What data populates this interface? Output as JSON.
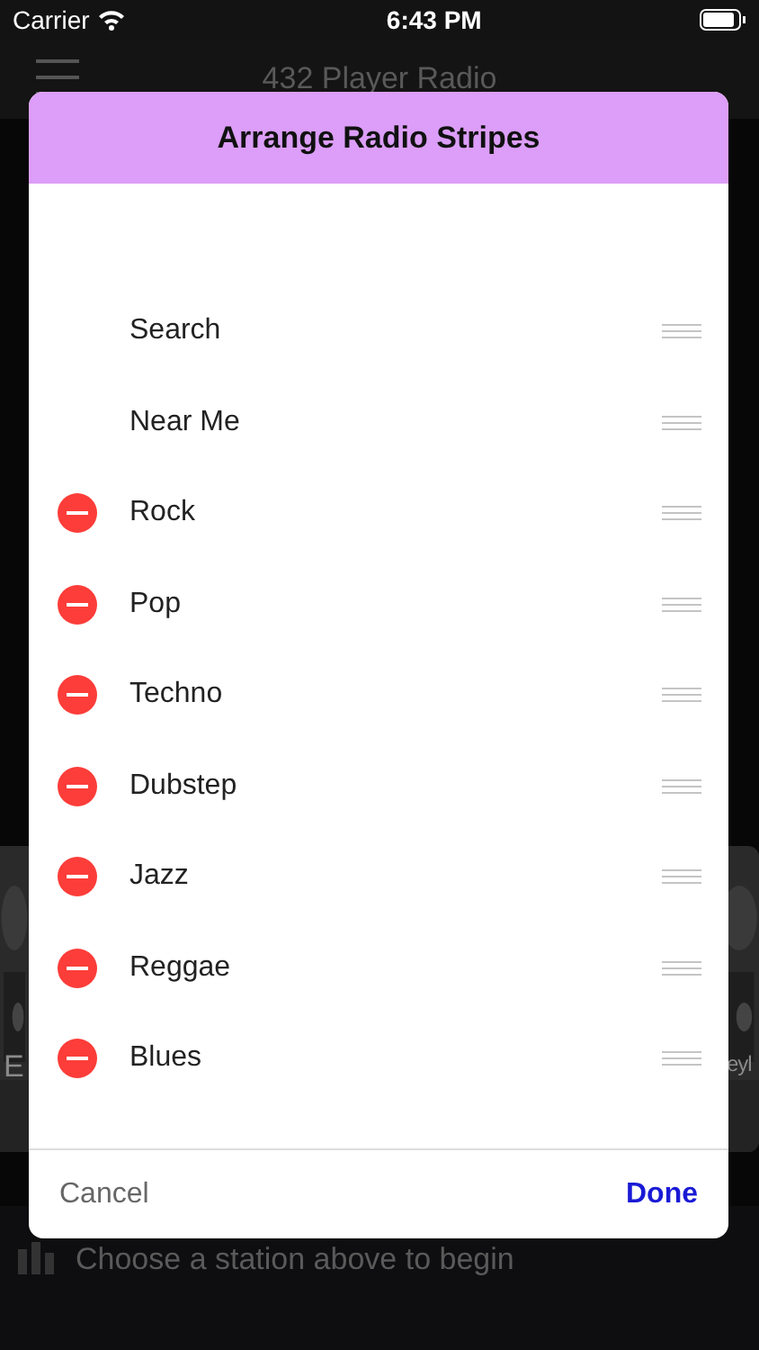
{
  "status_bar": {
    "carrier": "Carrier",
    "time": "6:43 PM"
  },
  "nav_bar": {
    "title": "432 Player Radio"
  },
  "background_cards": [
    {
      "label": "E"
    },
    {
      "label": "eyl"
    }
  ],
  "player_bar": {
    "text": "Choose a station above to begin"
  },
  "dialog": {
    "title": "Arrange Radio Stripes",
    "rows": [
      {
        "label": "Search",
        "deletable": false
      },
      {
        "label": "Near Me",
        "deletable": false
      },
      {
        "label": "Rock",
        "deletable": true
      },
      {
        "label": "Pop",
        "deletable": true
      },
      {
        "label": "Techno",
        "deletable": true
      },
      {
        "label": "Dubstep",
        "deletable": true
      },
      {
        "label": "Jazz",
        "deletable": true
      },
      {
        "label": "Reggae",
        "deletable": true
      },
      {
        "label": "Blues",
        "deletable": true
      }
    ],
    "cancel": "Cancel",
    "done": "Done"
  }
}
